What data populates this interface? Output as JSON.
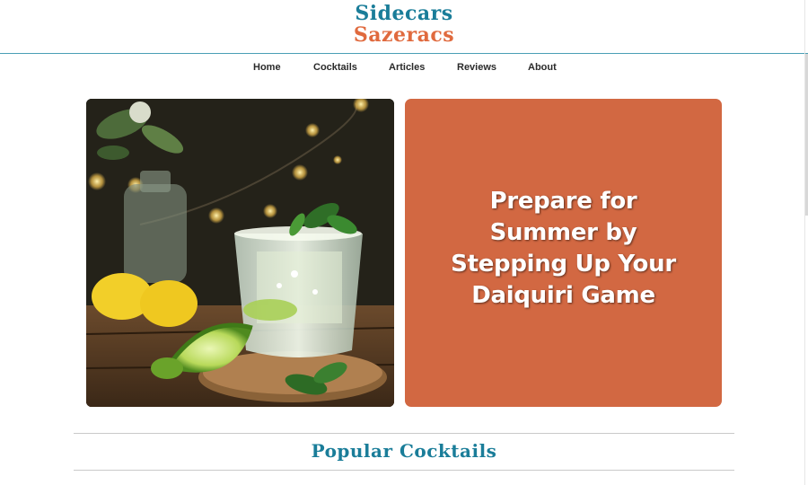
{
  "site": {
    "logo_line1": "Sidecars",
    "logo_line2": "Sazeracs"
  },
  "nav": {
    "items": [
      {
        "label": "Home"
      },
      {
        "label": "Cocktails"
      },
      {
        "label": "Articles"
      },
      {
        "label": "Reviews"
      },
      {
        "label": "About"
      }
    ]
  },
  "hero": {
    "image_icon": "cocktail-photo",
    "card_title": "Prepare for Summer by Stepping Up Your Daiquiri Game",
    "card_color": "#d26842"
  },
  "section": {
    "title": "Popular Cocktails"
  },
  "colors": {
    "brand_teal": "#1a7d99",
    "brand_orange": "#e06a3e",
    "header_rule": "#4a9fb5"
  }
}
